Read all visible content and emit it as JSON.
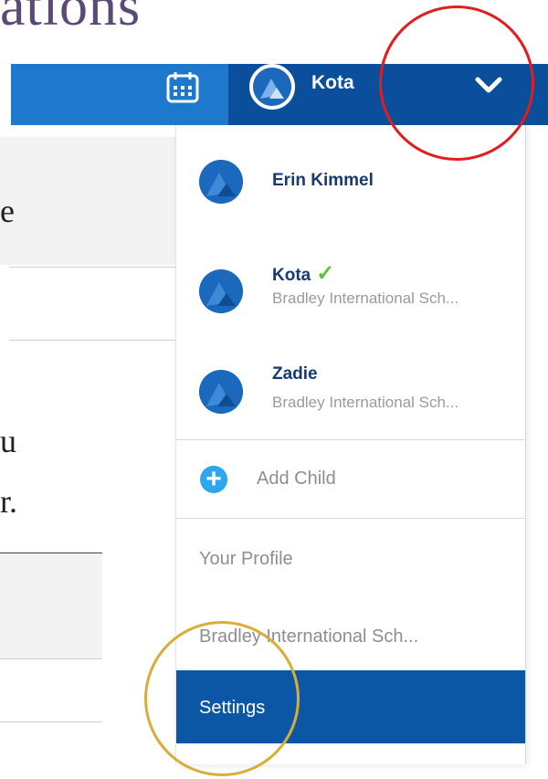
{
  "header": {
    "heading_fragment": "ations",
    "user_name": "Kota"
  },
  "background_fragments": {
    "line1": "e",
    "line2": "u",
    "line3": "r."
  },
  "menu": {
    "children": [
      {
        "name": "Erin Kimmel",
        "school": "",
        "selected": false
      },
      {
        "name": "Kota",
        "school": "Bradley International Sch...",
        "selected": true
      },
      {
        "name": "Zadie",
        "school": "Bradley International Sch...",
        "selected": false
      }
    ],
    "add_child_label": "Add Child",
    "your_profile_label": "Your Profile",
    "school_link_label": "Bradley International Sch...",
    "settings_label": "Settings"
  },
  "colors": {
    "brand_blue": "#0c56a6",
    "topbar_light": "#1e78cc",
    "add_icon": "#2ea6ee",
    "check_green": "#5cc33a",
    "highlight_red": "#e11d1d",
    "highlight_gold": "#d8ad3a"
  },
  "icons": {
    "calendar": "calendar-icon",
    "chevron": "chevron-down-icon",
    "avatar": "avatar-icon",
    "add": "plus-circle-icon",
    "check": "checkmark-icon"
  }
}
